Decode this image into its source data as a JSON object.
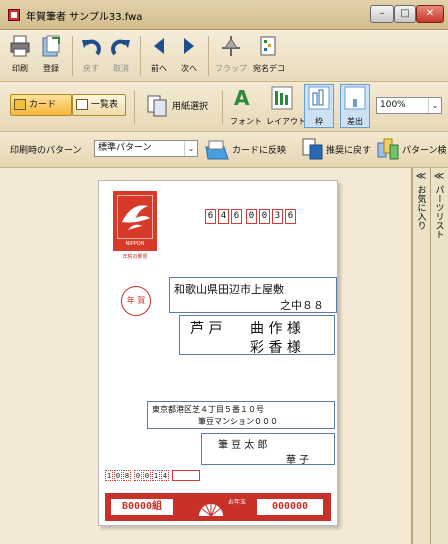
{
  "window": {
    "title": "年賀筆者 サンプル33.fwa",
    "min": "–",
    "max": "□",
    "close": "✕"
  },
  "toolbar1": {
    "items": [
      {
        "label": "印刷",
        "icon": "printer-icon"
      },
      {
        "label": "登録",
        "icon": "register-icon"
      },
      {
        "label": "戻す",
        "icon": "undo-icon"
      },
      {
        "label": "取消",
        "icon": "redo-icon"
      },
      {
        "label": "前へ",
        "icon": "previous-icon"
      },
      {
        "label": "次へ",
        "icon": "next-icon"
      },
      {
        "label": "フラップ",
        "icon": "flap-icon"
      },
      {
        "label": "宛名デコ",
        "icon": "address-deco-icon"
      }
    ]
  },
  "toolbar2": {
    "card_tab": "カード",
    "list_tab": "一覧表",
    "paper_select": "用紙選択",
    "font": "フォント",
    "layout": "レイアウト",
    "frame": "枠",
    "sender": "差出",
    "zoom": "100%"
  },
  "toolbar3": {
    "print_pattern_label": "印刷時のパターン",
    "print_pattern_value": "標準パターン",
    "apply_to_card": "カードに反映",
    "restore_recommended": "推奨に戻す",
    "pattern_search": "パターン検"
  },
  "side_tabs": {
    "favorites": "お気に入り",
    "parts_list": "パーツリスト",
    "chevron": "≪"
  },
  "card": {
    "stamp_text": "NIPPON",
    "stamp_sub": "年賀の郵便",
    "postcode": [
      "6",
      "4",
      "6",
      "0",
      "0",
      "3",
      "6"
    ],
    "nenga": "年 賀",
    "address_line1": "和歌山県田辺市上屋敷",
    "address_line2": "之中８８",
    "recipient1_surname": "芦 戸",
    "recipient1_given": "曲 作 様",
    "recipient2_given": "彩 香 様",
    "sender_address1": "東京都港区芝４丁目５番１０号",
    "sender_address2": "筆豆マンション０００",
    "sender_name1": "筆 豆 太 郎",
    "sender_name2": "華 子",
    "sender_postcode": [
      "1",
      "0",
      "8",
      "0",
      "0",
      "1",
      "4"
    ],
    "lottery_left": "B0000組",
    "lottery_right": "000000",
    "lottery_tag": "お年玉"
  }
}
